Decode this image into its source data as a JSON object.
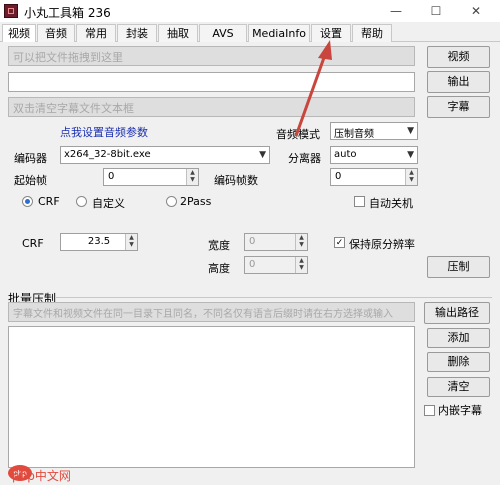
{
  "window": {
    "title": "小丸工具箱 236",
    "minimize": "—",
    "maximize": "☐",
    "close": "✕"
  },
  "tabs": [
    {
      "label": "视频",
      "active": true
    },
    {
      "label": "音频"
    },
    {
      "label": "常用"
    },
    {
      "label": "封装"
    },
    {
      "label": "抽取"
    },
    {
      "label": "AVS"
    },
    {
      "label": "MediaInfo"
    },
    {
      "label": "设置"
    },
    {
      "label": "帮助"
    }
  ],
  "video": {
    "input_placeholder": "可以把文件拖拽到这里",
    "output_value": "",
    "subtitle_placeholder": "双击清空字幕文件文本框",
    "btn_video": "视频",
    "btn_output": "输出",
    "btn_subtitle": "字幕",
    "audio_settings_link": "点我设置音频参数",
    "audio_mode_label": "音频模式",
    "audio_mode_value": "压制音频",
    "encoder_label": "编码器",
    "encoder_value": "x264_32-8bit.exe",
    "splitter_label": "分离器",
    "splitter_value": "auto",
    "start_frame_label": "起始帧",
    "start_frame_value": "0",
    "encode_frames_label": "编码帧数",
    "encode_frames_value": "0",
    "radio_crf": "CRF",
    "radio_custom": "自定义",
    "radio_2pass": "2Pass",
    "auto_shutdown": "自动关机",
    "crf_label": "CRF",
    "crf_value": "23.5",
    "width_label": "宽度",
    "width_value": "0",
    "height_label": "高度",
    "height_value": "0",
    "keep_ratio": "保持原分辨率",
    "btn_compress": "压制"
  },
  "batch": {
    "title": "批量压制",
    "hint_placeholder": "字幕文件和视频文件在同一目录下且同名，不同名仅有语言后缀时请在右方选择或输入",
    "btn_output_path": "输出路径",
    "btn_add": "添加",
    "btn_delete": "删除",
    "btn_clear": "清空",
    "partial_label": "内嵌字幕"
  },
  "watermark": {
    "text": "php中文网"
  },
  "colors": {
    "arrow": "#c8463d",
    "link": "#1a2fb0"
  }
}
